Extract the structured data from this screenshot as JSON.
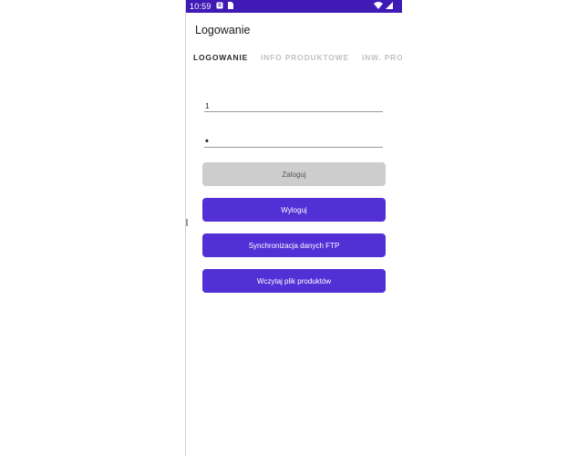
{
  "status_bar": {
    "time": "10:59",
    "left_icons": [
      "notification-icon",
      "sim-card-icon"
    ],
    "right_icons": [
      "wifi-icon",
      "signal-icon"
    ]
  },
  "app": {
    "title": "Logowanie"
  },
  "tabs": [
    {
      "label": "LOGOWANIE",
      "active": true
    },
    {
      "label": "INFO PRODUKTOWE",
      "active": false
    },
    {
      "label": "INW. PROST",
      "active": false
    }
  ],
  "form": {
    "login_value": "1",
    "password_value": "•"
  },
  "buttons": {
    "login": "Zaloguj",
    "logout": "Wyloguj",
    "ftp_sync": "Synchronizacja danych FTP",
    "load_products": "Wczytaj plik produktów"
  },
  "colors": {
    "status_bar": "#3f1ab5",
    "primary": "#5330d6",
    "disabled": "#cdcdcd"
  }
}
